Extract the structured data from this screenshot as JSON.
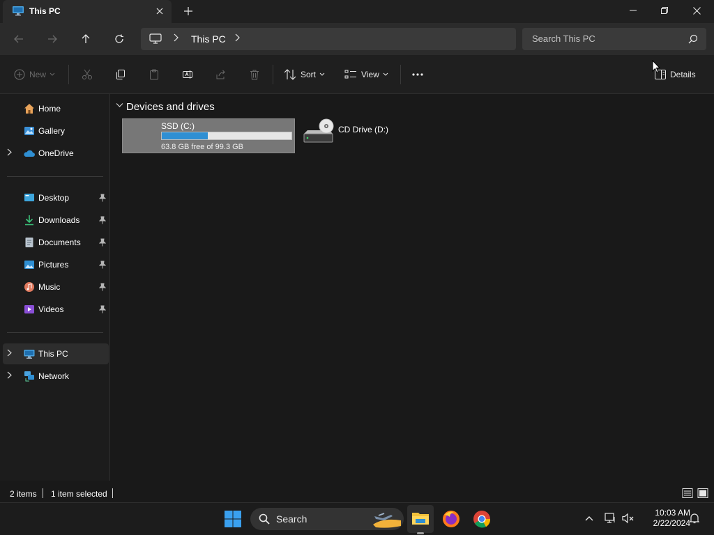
{
  "window": {
    "tab_title": "This PC",
    "tab_close": "close-tab",
    "new_tab": "+",
    "controls": [
      "minimize",
      "restore",
      "close"
    ]
  },
  "navigation": {
    "back": "back",
    "forward": "forward",
    "up": "up",
    "refresh": "refresh",
    "breadcrumb": [
      "This PC"
    ],
    "search_placeholder": "Search This PC"
  },
  "commandbar": {
    "new_label": "New",
    "sort_label": "Sort",
    "view_label": "View",
    "details_label": "Details"
  },
  "sidebar": {
    "top": [
      {
        "label": "Home",
        "icon": "home-icon"
      },
      {
        "label": "Gallery",
        "icon": "gallery-icon"
      },
      {
        "label": "OneDrive",
        "icon": "onedrive-icon",
        "expandable": true
      }
    ],
    "quick_access": [
      {
        "label": "Desktop",
        "icon": "desktop-icon",
        "pinned": true
      },
      {
        "label": "Downloads",
        "icon": "downloads-icon",
        "pinned": true
      },
      {
        "label": "Documents",
        "icon": "documents-icon",
        "pinned": true
      },
      {
        "label": "Pictures",
        "icon": "pictures-icon",
        "pinned": true
      },
      {
        "label": "Music",
        "icon": "music-icon",
        "pinned": true
      },
      {
        "label": "Videos",
        "icon": "videos-icon",
        "pinned": true
      }
    ],
    "locations": [
      {
        "label": "This PC",
        "icon": "this-pc-icon",
        "selected": true
      },
      {
        "label": "Network",
        "icon": "network-icon"
      }
    ]
  },
  "main": {
    "group_title": "Devices and drives",
    "drives": [
      {
        "name": "SSD (C:)",
        "free_text": "63.8 GB free of 99.3 GB",
        "used_fraction": 0.357,
        "selected": true
      },
      {
        "name": "CD Drive (D:)"
      }
    ]
  },
  "status": {
    "items_count": "2 items",
    "selection": "1 item selected"
  },
  "taskbar": {
    "search_label": "Search",
    "apps": [
      "start-icon",
      "file-explorer-icon",
      "firefox-icon",
      "chrome-icon"
    ],
    "clock_time": "10:03 AM",
    "clock_date": "2/22/2024"
  },
  "colors": {
    "accent": "#2f8fd3",
    "background": "#191919",
    "selected_drive": "#777777"
  }
}
